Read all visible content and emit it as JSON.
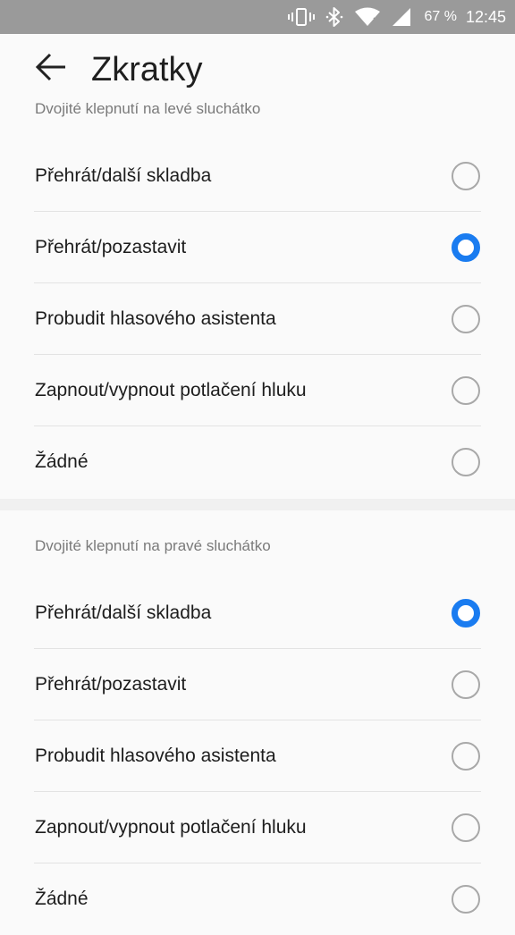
{
  "status_bar": {
    "battery": "67 %",
    "time": "12:45",
    "icons": [
      "vibrate-icon",
      "bluetooth-icon",
      "wifi-icon",
      "signal-icon"
    ]
  },
  "header": {
    "title": "Zkratky",
    "back_icon": "arrow-left-icon"
  },
  "left_section": {
    "label": "Dvojité klepnutí na levé sluchátko",
    "options": [
      {
        "label": "Přehrát/další skladba",
        "checked": false
      },
      {
        "label": "Přehrát/pozastavit",
        "checked": true
      },
      {
        "label": "Probudit hlasového asistenta",
        "checked": false
      },
      {
        "label": "Zapnout/vypnout potlačení hluku",
        "checked": false
      },
      {
        "label": "Žádné",
        "checked": false
      }
    ]
  },
  "right_section": {
    "label": "Dvojité klepnutí na pravé sluchátko",
    "options": [
      {
        "label": "Přehrát/další skladba",
        "checked": true
      },
      {
        "label": "Přehrát/pozastavit",
        "checked": false
      },
      {
        "label": "Probudit hlasového asistenta",
        "checked": false
      },
      {
        "label": "Zapnout/vypnout potlačení hluku",
        "checked": false
      },
      {
        "label": "Žádné",
        "checked": false
      }
    ]
  },
  "colors": {
    "accent": "#1a7cf0",
    "status_bar_bg": "#9a9a9a",
    "background": "#fafafa"
  }
}
